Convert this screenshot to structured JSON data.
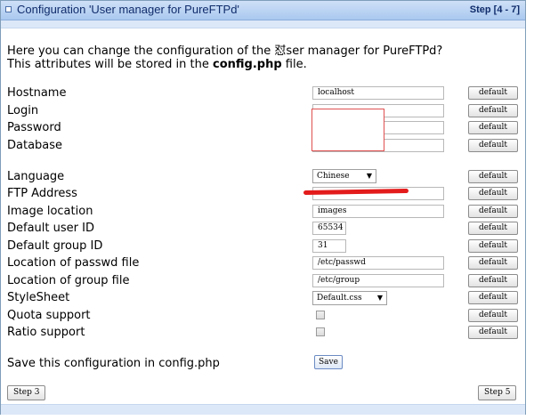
{
  "panel": {
    "title": "Configuration 'User manager for PureFTPd'",
    "step": "Step [4 - 7]"
  },
  "intro": {
    "line1_a": "Here you can change the configuration of the ",
    "line1_glyph": "怼",
    "line1_b": "ser manager for PureFTPd?",
    "line2_a": "This attributes will be stored in the ",
    "line2_file": "config.php",
    "line2_b": " file."
  },
  "default_label": "default",
  "fields": {
    "hostname": {
      "label": "Hostname",
      "value": "localhost"
    },
    "login": {
      "label": "Login",
      "value": ""
    },
    "password": {
      "label": "Password",
      "value": ""
    },
    "database": {
      "label": "Database",
      "value": ""
    },
    "language": {
      "label": "Language",
      "value": "Chinese"
    },
    "ftp_address": {
      "label": "FTP Address",
      "value": ""
    },
    "image_location": {
      "label": "Image location",
      "value": "images"
    },
    "default_user_id": {
      "label": "Default user ID",
      "value": "65534"
    },
    "default_group_id": {
      "label": "Default group ID",
      "value": "31"
    },
    "passwd_file": {
      "label": "Location of passwd file",
      "value": "/etc/passwd"
    },
    "group_file": {
      "label": "Location of group file",
      "value": "/etc/group"
    },
    "stylesheet": {
      "label": "StyleSheet",
      "value": "Default.css"
    },
    "quota_support": {
      "label": "Quota support",
      "checked": false
    },
    "ratio_support": {
      "label": "Ratio support",
      "checked": false
    }
  },
  "save": {
    "label": "Save this configuration in config.php",
    "button": "Save"
  },
  "nav": {
    "prev": "Step 3",
    "next": "Step 5"
  },
  "colors": {
    "title_bar": "#a9c8ef",
    "redaction": "#e31b1b"
  }
}
